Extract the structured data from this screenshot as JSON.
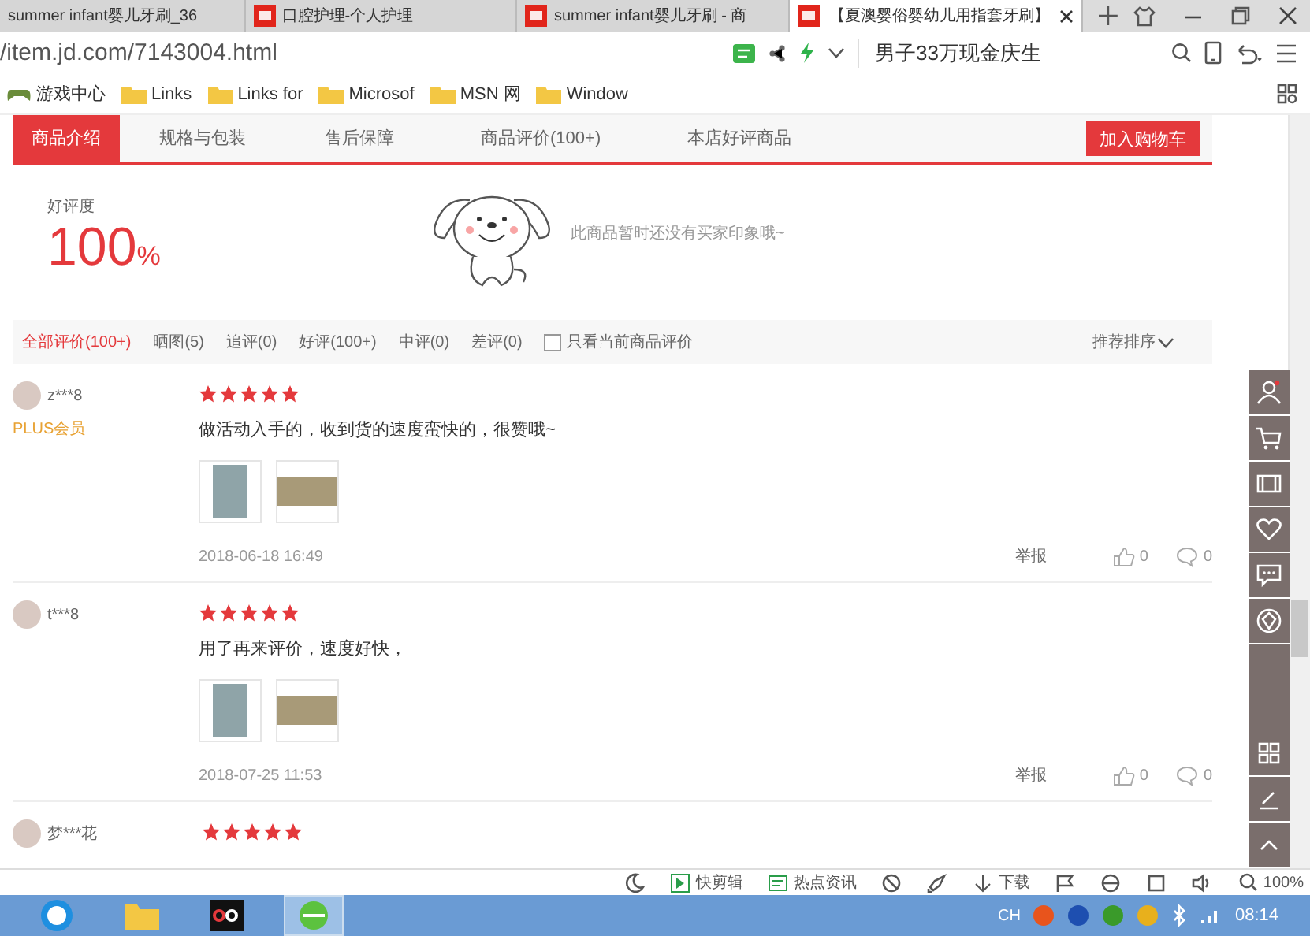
{
  "browser": {
    "tabs": [
      {
        "title": "summer infant婴儿牙刷_36",
        "selected": false
      },
      {
        "title": "口腔护理-个人护理",
        "selected": false
      },
      {
        "title": "summer infant婴儿牙刷 - 商",
        "selected": false
      },
      {
        "title": "【夏澳婴俗婴幼儿用指套牙刷】",
        "selected": true
      }
    ],
    "address": "/item.jd.com/7143004.html",
    "search": "男子33万现金庆生",
    "bookmarks": [
      {
        "label": "游戏中心",
        "kind": "game"
      },
      {
        "label": "Links",
        "kind": "folder"
      },
      {
        "label": "Links for",
        "kind": "folder"
      },
      {
        "label": "Microsof",
        "kind": "folder"
      },
      {
        "label": "MSN 网",
        "kind": "folder"
      },
      {
        "label": "Window",
        "kind": "folder"
      }
    ]
  },
  "page": {
    "nav": [
      {
        "label": "商品介绍",
        "selected": true
      },
      {
        "label": "规格与包装",
        "selected": false
      },
      {
        "label": "售后保障",
        "selected": false
      },
      {
        "label": "商品评价(100+)",
        "selected": false
      },
      {
        "label": "本店好评商品",
        "selected": false
      }
    ],
    "cart_button": "加入购物车",
    "rating": {
      "label": "好评度",
      "value": "100",
      "unit": "%"
    },
    "impression": "此商品暂时还没有买家印象哦~",
    "filters": [
      {
        "label": "全部评价(100+)",
        "selected": true
      },
      {
        "label": "晒图(5)",
        "selected": false
      },
      {
        "label": "追评(0)",
        "selected": false
      },
      {
        "label": "好评(100+)",
        "selected": false
      },
      {
        "label": "中评(0)",
        "selected": false
      },
      {
        "label": "差评(0)",
        "selected": false
      }
    ],
    "only_current": {
      "label": "只看当前商品评价",
      "checked": false
    },
    "sort": "推荐排序",
    "reviews": [
      {
        "user": "z***8",
        "badge": "PLUS会员",
        "stars": 5,
        "text": "做活动入手的，收到货的速度蛮快的，很赞哦~",
        "photos": [
          {
            "kind": "tall"
          },
          {
            "kind": "wide"
          }
        ],
        "date": "2018-06-18 16:49",
        "report": "举报",
        "likes": "0",
        "replies": "0"
      },
      {
        "user": "t***8",
        "stars": 5,
        "text": "用了再来评价，速度好快，",
        "photos": [
          {
            "kind": "tall"
          },
          {
            "kind": "wide"
          }
        ],
        "date": "2018-07-25 11:53",
        "report": "举报",
        "likes": "0",
        "replies": "0"
      },
      {
        "user": "梦***花",
        "stars": 5
      }
    ]
  },
  "status_bar": {
    "items": [
      "快剪辑",
      "热点资讯",
      "下载"
    ],
    "zoom": "100%"
  },
  "taskbar": {
    "lang": "CH",
    "time": "08:14"
  }
}
